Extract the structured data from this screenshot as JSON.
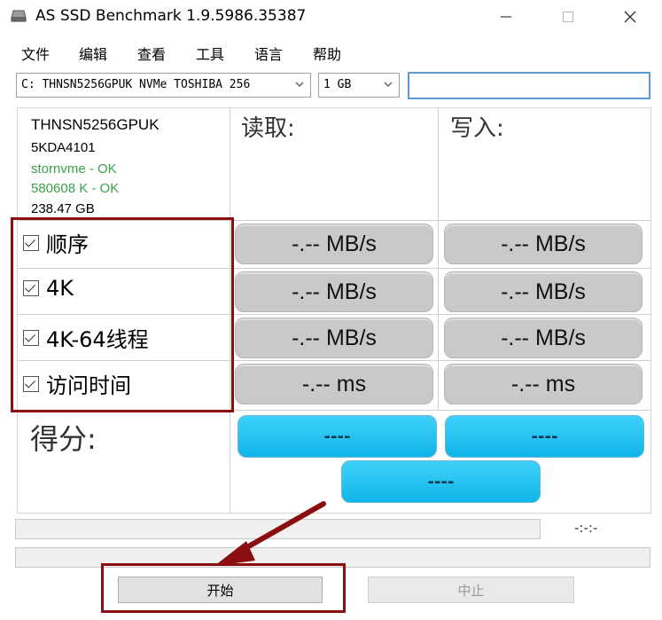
{
  "window": {
    "title": "AS SSD Benchmark 1.9.5986.35387"
  },
  "menu": [
    "文件",
    "编辑",
    "查看",
    "工具",
    "语言",
    "帮助"
  ],
  "toolbar": {
    "drive": "C: THNSN5256GPUK NVMe TOSHIBA 256",
    "size": "1 GB",
    "text_value": ""
  },
  "drive_info": {
    "model": "THNSN5256GPUK",
    "firmware": "5KDA4101",
    "driver_status": "stornvme - OK",
    "alignment_status": "580608 K - OK",
    "capacity": "238.47 GB"
  },
  "columns": {
    "read": "读取:",
    "write": "写入:"
  },
  "tests": [
    {
      "label": "顺序",
      "read": "-.-- MB/s",
      "write": "-.-- MB/s"
    },
    {
      "label": "4K",
      "read": "-.-- MB/s",
      "write": "-.-- MB/s"
    },
    {
      "label": "4K-64线程",
      "read": "-.-- MB/s",
      "write": "-.-- MB/s"
    },
    {
      "label": "访问时间",
      "read": "-.-- ms",
      "write": "-.-- ms"
    }
  ],
  "score": {
    "label": "得分:",
    "read": "----",
    "write": "----",
    "total": "----"
  },
  "status": {
    "timer": "-:-:-"
  },
  "buttons": {
    "start": "开始",
    "stop": "中止"
  },
  "colors": {
    "highlight_border": "#8b0f10",
    "score_button": "#1ab8ec",
    "ok_text": "#3aa04a",
    "input_focus": "#5b9bd5"
  },
  "icons": {
    "app": "disk-drive-icon",
    "minimize": "minimize-icon",
    "maximize": "maximize-icon",
    "close": "close-icon",
    "dropdown": "chevron-down-icon",
    "checkbox": "checkbox-checked-icon",
    "annotation": "arrow-annotation-icon"
  }
}
